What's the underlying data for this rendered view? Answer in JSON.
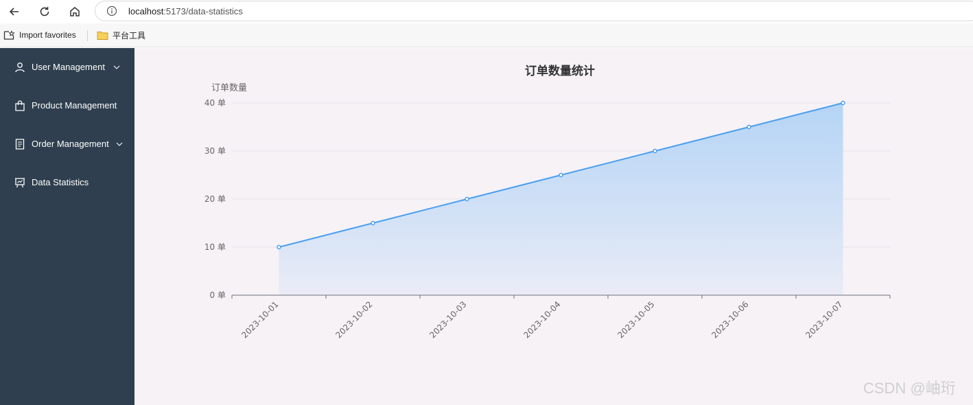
{
  "browser": {
    "url_host": "localhost",
    "url_path": ":5173/data-statistics"
  },
  "bookmarks": {
    "items": [
      {
        "label": "Import favorites",
        "icon": "import-favorites-icon"
      },
      {
        "label": "平台工具",
        "icon": "folder-icon"
      }
    ]
  },
  "sidebar": {
    "items": [
      {
        "label": "User Management",
        "icon": "user-icon",
        "has_submenu": true
      },
      {
        "label": "Product Management",
        "icon": "shopping-bag-icon",
        "has_submenu": false
      },
      {
        "label": "Order Management",
        "icon": "document-icon",
        "has_submenu": true
      },
      {
        "label": "Data Statistics",
        "icon": "chart-board-icon",
        "has_submenu": false
      }
    ],
    "background": "#2f3f4f"
  },
  "chart_data": {
    "type": "area",
    "title": "订单数量统计",
    "xlabel": "",
    "ylabel": "订单数量",
    "y_unit_suffix": " 单",
    "categories": [
      "2023-10-01",
      "2023-10-02",
      "2023-10-03",
      "2023-10-04",
      "2023-10-05",
      "2023-10-06",
      "2023-10-07"
    ],
    "series": [
      {
        "values": [
          10,
          15,
          20,
          25,
          30,
          35,
          40
        ],
        "color": "#4a9ff0"
      }
    ],
    "ylim": [
      0,
      40
    ],
    "y_ticks": [
      0,
      10,
      20,
      30,
      40
    ],
    "grid": true,
    "legend": "none"
  },
  "watermark": "CSDN @岫珩"
}
